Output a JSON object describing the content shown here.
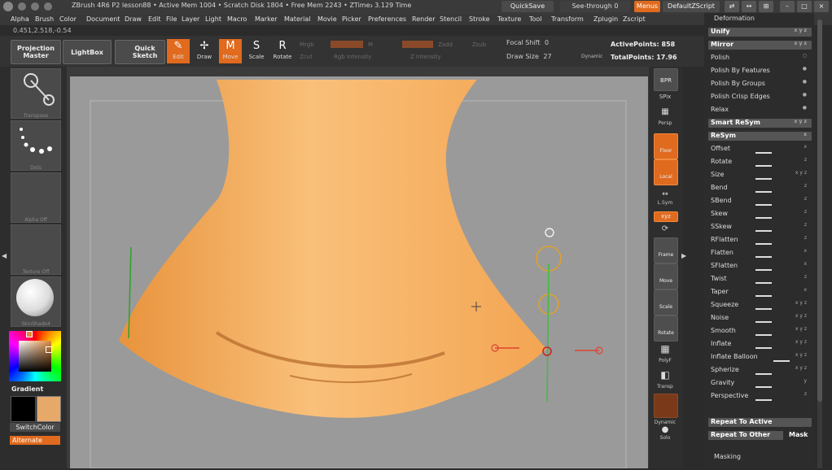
{
  "window": {
    "title": "ZBrush 4R6 P2    lesson88  • Active Mem 1004 • Scratch Disk 1804 • Free Mem 2243 • ZTime₃ 3.129 Time",
    "quicksave": "QuickSave",
    "seethrough": "See-through  0",
    "menus": "Menus",
    "script": "DefaultZScript"
  },
  "menu": [
    "Alpha",
    "Brush",
    "Color",
    "Document",
    "Draw",
    "Edit",
    "File",
    "Layer",
    "Light",
    "Macro",
    "Marker",
    "Material",
    "Movie",
    "Picker",
    "Preferences",
    "Render",
    "Stencil",
    "Stroke",
    "Texture",
    "Tool",
    "Transform",
    "Zplugin",
    "Zscript"
  ],
  "coords": "0.451,2.518,-0.54",
  "toolbar": {
    "projection_master": "Projection Master",
    "lightbox": "LightBox",
    "quick_sketch": "Quick Sketch",
    "edit": "Edit",
    "draw": "Draw",
    "move": "Move",
    "scale": "Scale",
    "rotate": "Rotate",
    "mrgb": "Mrgb",
    "m": "M",
    "zadd": "Zadd",
    "zsub": "Zsub",
    "zcut": "Zcut",
    "rgb_intensity": "Rgb Intensity",
    "z_intensity": "Z Intensity",
    "focal_shift": "Focal Shift",
    "focal_value": "0",
    "draw_size": "Draw Size",
    "draw_size_value": "27",
    "dynamic": "Dynamic",
    "active_points": "ActivePoints: 858",
    "total_points": "TotalPoints: 17.96"
  },
  "left": {
    "transpose": "Transpose",
    "dots": "Dots",
    "alpha": "Alpha Off",
    "texture": "Texture Off",
    "material": "SkinShade4",
    "gradient": "Gradient",
    "switchcolor": "SwitchColor",
    "alternate": "Alternate"
  },
  "right": {
    "bpr": "BPR",
    "spix": "SPix",
    "persp": "Persp",
    "floor": "Floor",
    "local": "Local",
    "lsym": "L.Sym",
    "xyz": "xyz",
    "frame": "Frame",
    "move": "Move",
    "scale": "Scale",
    "rotate": "Rotate",
    "polyf": "PolyF",
    "transp": "Transp",
    "dynamic": "Dynamic",
    "solo": "Solo"
  },
  "panel": {
    "title": "Deformation",
    "items": [
      {
        "label": "Unify",
        "type": "hdr"
      },
      {
        "label": "Mirror",
        "type": "hdr"
      },
      {
        "label": "Polish",
        "type": "row"
      },
      {
        "label": "Polish By Features",
        "type": "row"
      },
      {
        "label": "Polish By Groups",
        "type": "row"
      },
      {
        "label": "Polish Crisp Edges",
        "type": "row"
      },
      {
        "label": "Relax",
        "type": "row"
      },
      {
        "label": "Smart ReSym",
        "type": "hdr"
      },
      {
        "label": "ReSym",
        "type": "hdr"
      },
      {
        "label": "Offset",
        "type": "row"
      },
      {
        "label": "Rotate",
        "type": "row"
      },
      {
        "label": "Size",
        "type": "row"
      },
      {
        "label": "Bend",
        "type": "row"
      },
      {
        "label": "SBend",
        "type": "row"
      },
      {
        "label": "Skew",
        "type": "row"
      },
      {
        "label": "SSkew",
        "type": "row"
      },
      {
        "label": "RFlatten",
        "type": "row"
      },
      {
        "label": "Flatten",
        "type": "row"
      },
      {
        "label": "SFlatten",
        "type": "row"
      },
      {
        "label": "Twist",
        "type": "row"
      },
      {
        "label": "Taper",
        "type": "row"
      },
      {
        "label": "Squeeze",
        "type": "row"
      },
      {
        "label": "Noise",
        "type": "row"
      },
      {
        "label": "Smooth",
        "type": "row"
      },
      {
        "label": "Inflate",
        "type": "row"
      },
      {
        "label": "Inflate Balloon",
        "type": "row"
      },
      {
        "label": "Spherize",
        "type": "row"
      },
      {
        "label": "Gravity",
        "type": "row"
      },
      {
        "label": "Perspective",
        "type": "row"
      }
    ],
    "repeat_active": "Repeat To Active",
    "repeat_other": "Repeat To Other",
    "mask": "Mask",
    "masking": "Masking"
  }
}
